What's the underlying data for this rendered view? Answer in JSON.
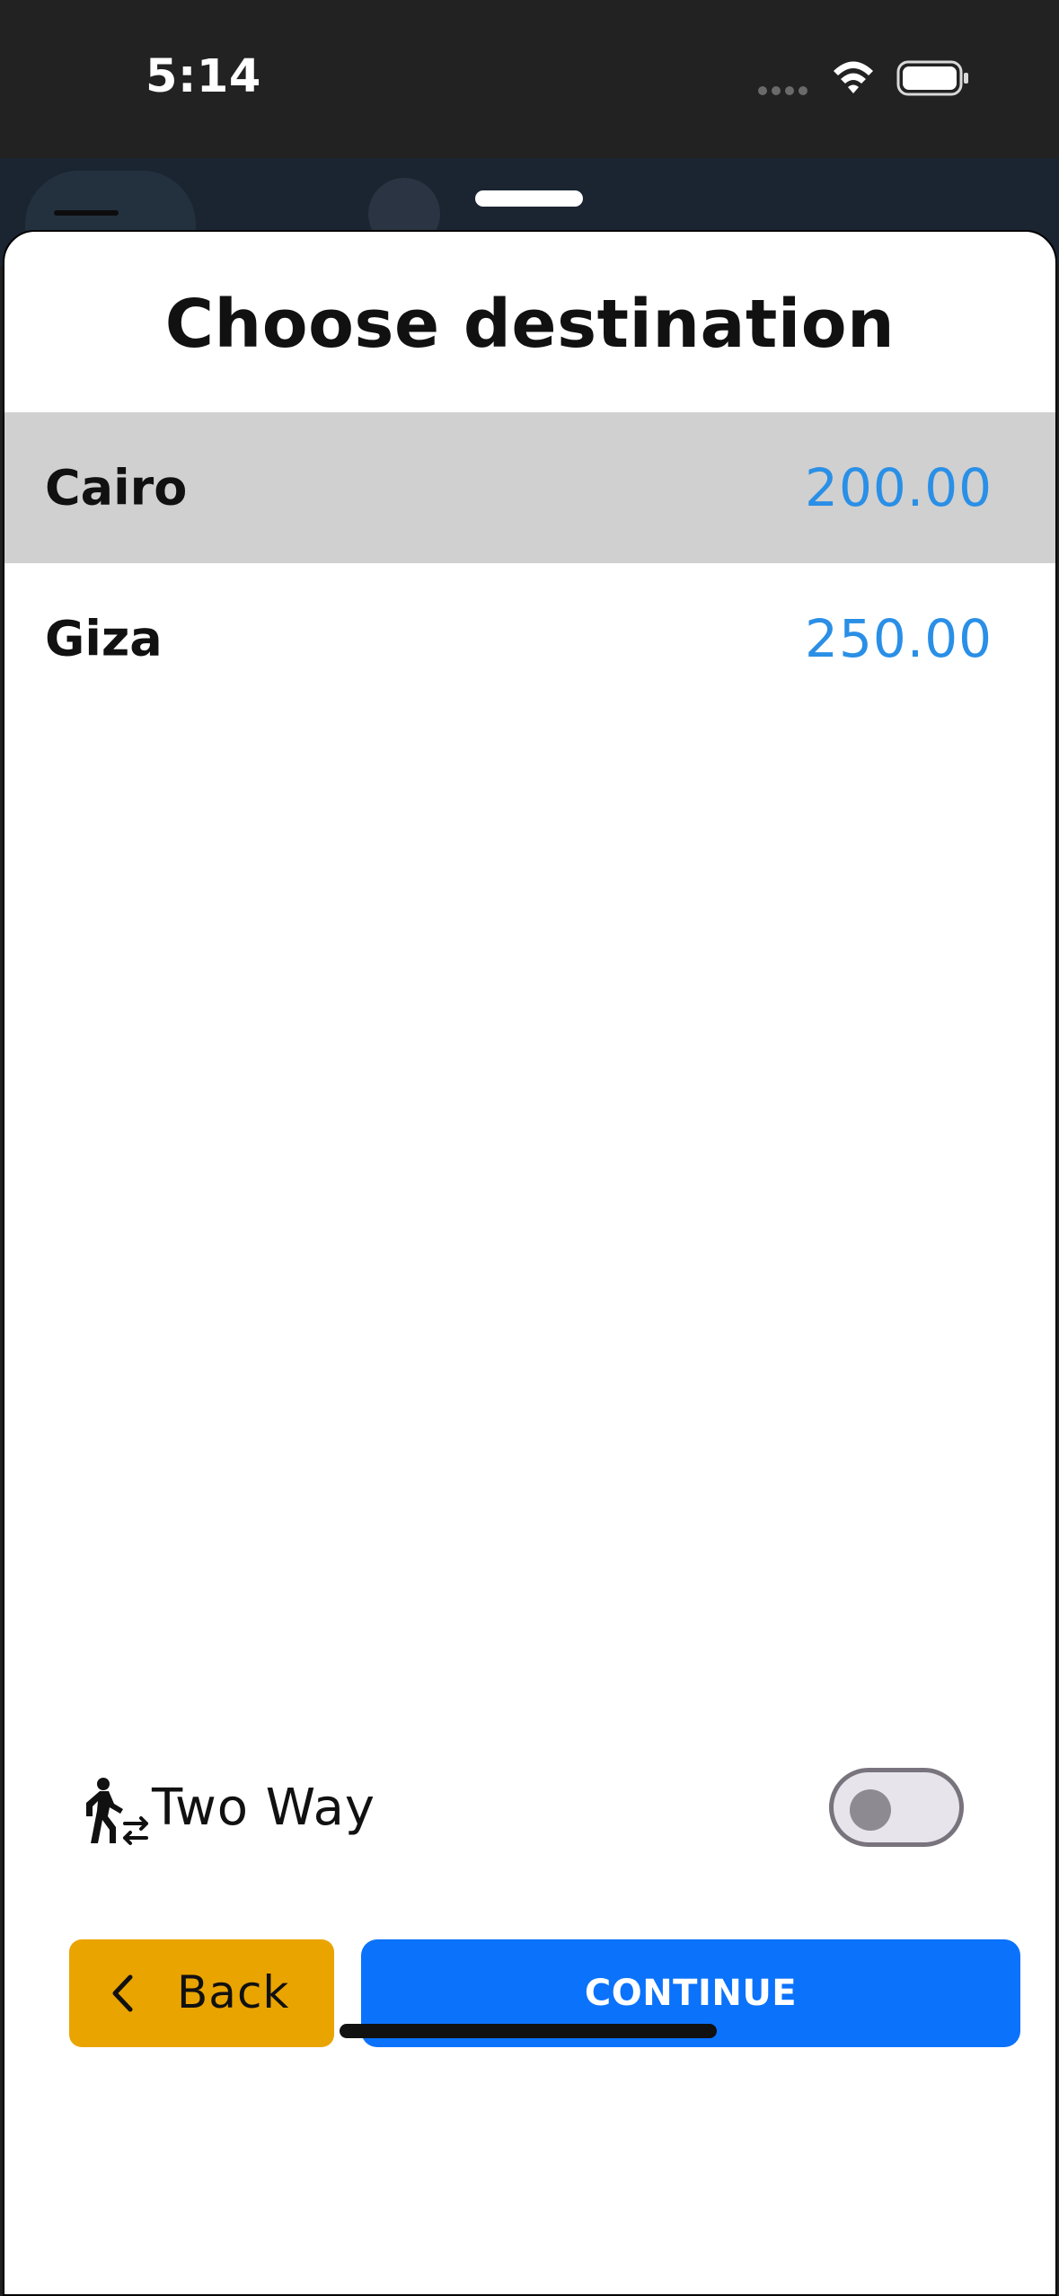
{
  "status_bar": {
    "time": "5:14",
    "icons": [
      "signal-dots-icon",
      "wifi-icon",
      "battery-icon"
    ]
  },
  "sheet": {
    "title": "Choose destination",
    "destinations": [
      {
        "name": "Cairo",
        "price": "200.00",
        "selected": true
      },
      {
        "name": "Giza",
        "price": "250.00",
        "selected": false
      }
    ],
    "two_way": {
      "label": "Two Way",
      "icon": "walking-person-arrows-icon",
      "enabled": false
    },
    "back_button": {
      "label": "Back",
      "icon": "chevron-left-icon"
    },
    "continue_button": {
      "label": "CONTINUE"
    }
  },
  "colors": {
    "selected_row": "#d0d0d0",
    "price": "#2a8fe6",
    "back_button": "#eaa400",
    "continue_button": "#0b72fb"
  }
}
